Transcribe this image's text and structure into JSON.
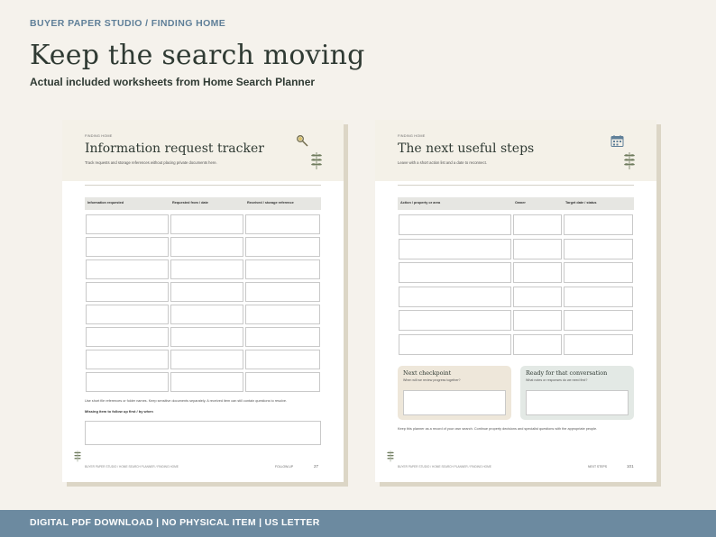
{
  "header": {
    "brand": "BUYER PAPER STUDIO  /  FINDING HOME",
    "headline": "Keep the search moving",
    "subline": "Actual included worksheets from Home Search Planner"
  },
  "left_sheet": {
    "eyebrow": "FINDING HOME",
    "title": "Information request tracker",
    "subtitle": "Track requests and storage references without placing private documents here.",
    "icon": "magnifier-icon",
    "columns": [
      "Information requested",
      "Requested from / date",
      "Received / storage reference"
    ],
    "row_count": 8,
    "note": "Use short file references or folder names. Keep sensitive documents separately. A received item can still contain questions to resolve.",
    "followup_label": "Missing item to follow up first / by when",
    "footer_left": "BUYER PAPER STUDIO  /  HOME SEARCH PLANNER  /  FINDING HOME",
    "footer_right": "FOLLOW-UP",
    "page": "27"
  },
  "right_sheet": {
    "eyebrow": "FINDING HOME",
    "title": "The next useful steps",
    "subtitle": "Leave with a short action list and a date to reconnect.",
    "icon": "calendar-icon",
    "columns": [
      "Action / property or area",
      "Owner",
      "Target date / status"
    ],
    "row_count": 6,
    "panels": [
      {
        "title": "Next checkpoint",
        "subtitle": "When will we review progress together?",
        "color": "#eee7da"
      },
      {
        "title": "Ready for that conversation",
        "subtitle": "What notes or responses do we need first?",
        "color": "#e3e9e5"
      }
    ],
    "note": "Keep this planner as a record of your own search. Continue property decisions and specialist questions with the appropriate people.",
    "footer_left": "BUYER PAPER STUDIO  /  HOME SEARCH PLANNER  /  FINDING HOME",
    "footer_right": "NEXT STEPS",
    "page": "101"
  },
  "bottom_bar": {
    "text": "DIGITAL PDF DOWNLOAD  |  NO PHYSICAL ITEM  |  US LETTER"
  },
  "colors": {
    "background": "#f5f2ec",
    "accent_blue": "#5f7f98",
    "bar_blue": "#6c8aa0",
    "leaf_green": "#6f7c5e"
  }
}
